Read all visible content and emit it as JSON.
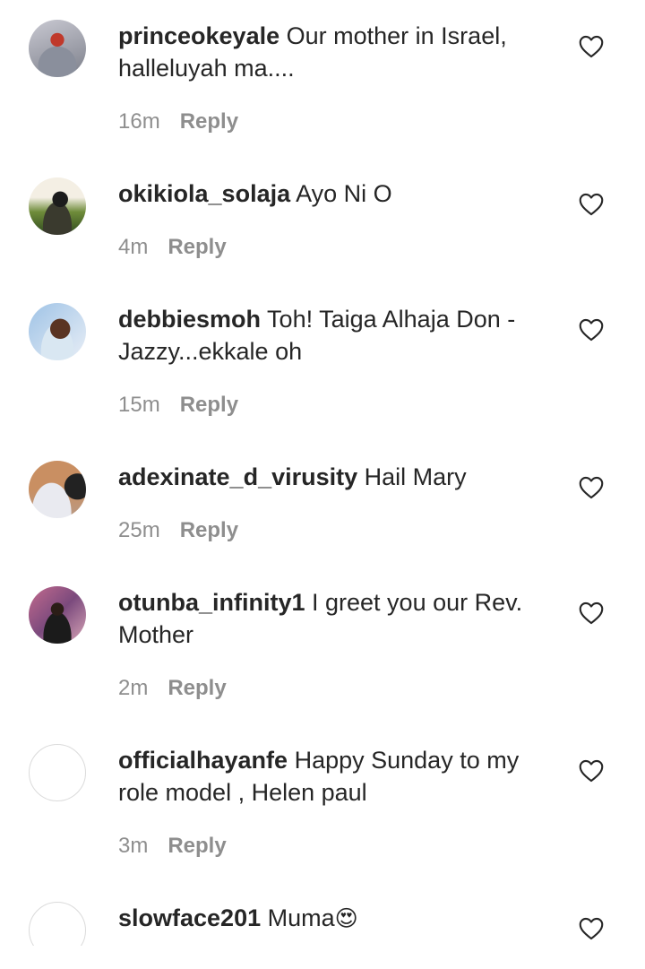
{
  "comments": [
    {
      "username": "princeokeyale",
      "text": "Our mother in Israel, halleluyah ma....",
      "time": "16m",
      "reply": "Reply",
      "avatar": "photo"
    },
    {
      "username": "okikiola_solaja",
      "text": "Ayo Ni O",
      "time": "4m",
      "reply": "Reply",
      "avatar": "photo"
    },
    {
      "username": "debbiesmoh",
      "text": "Toh! Taiga Alhaja Don - Jazzy...ekkale oh",
      "time": "15m",
      "reply": "Reply",
      "avatar": "photo"
    },
    {
      "username": "adexinate_d_virusity",
      "text": "Hail Mary",
      "time": "25m",
      "reply": "Reply",
      "avatar": "photo"
    },
    {
      "username": "otunba_infinity1",
      "text": "I greet you our Rev. Mother",
      "time": "2m",
      "reply": "Reply",
      "avatar": "photo"
    },
    {
      "username": "officialhayanfe",
      "text": "Happy Sunday to my role model , Helen paul",
      "time": "3m",
      "reply": "Reply",
      "avatar": "empty"
    },
    {
      "username": "slowface201",
      "text": "Muma",
      "emoji": "😍",
      "avatar": "empty"
    }
  ],
  "icons": {
    "like": "heart-outline-icon"
  },
  "colors": {
    "text": "#262626",
    "muted": "#8e8e8e",
    "background": "#ffffff"
  }
}
